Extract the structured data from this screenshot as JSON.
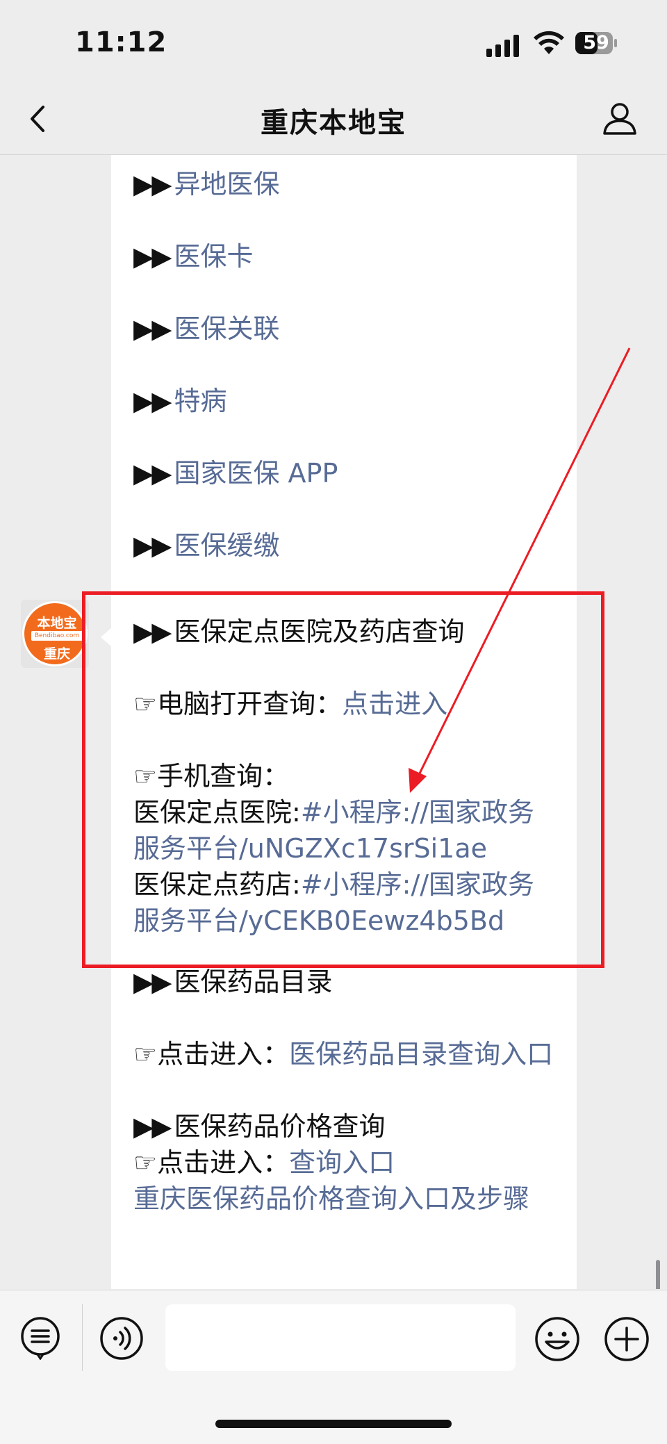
{
  "status_bar": {
    "time": "11:12",
    "battery": "59"
  },
  "nav": {
    "title": "重庆本地宝"
  },
  "bubble1": {
    "items": [
      {
        "marker": "▶▶",
        "label": "异地医保"
      },
      {
        "marker": "▶▶",
        "label": "医保卡"
      },
      {
        "marker": "▶▶",
        "label": "医保关联"
      },
      {
        "marker": "▶▶",
        "label": "特病"
      },
      {
        "marker": "▶▶",
        "label": "国家医保 APP"
      },
      {
        "marker": "▶▶",
        "label": "医保缓缴"
      }
    ]
  },
  "avatar": {
    "top_text": "本地宝",
    "mid_text": "Bendibao.com",
    "bottom_text": "重庆"
  },
  "bubble2": {
    "section1_marker": "▶▶",
    "section1_title": "医保定点医院及药店查询",
    "hand": "☞",
    "pc_label": "电脑打开查询：",
    "pc_link": "点击进入",
    "mobile_label": "手机查询：",
    "hospital_label": "医保定点医院:",
    "hospital_link": "#小程序://国家政务服务平台/uNGZXc17srSi1ae",
    "pharmacy_label": "医保定点药店:",
    "pharmacy_link": "#小程序://国家政务服务平台/yCEKB0Eewz4b5Bd",
    "section2_marker": "▶▶",
    "section2_title": "医保药品目录",
    "catalog_label": "点击进入：",
    "catalog_link": "医保药品目录查询入口",
    "section3_marker": "▶▶",
    "section3_title": "医保药品价格查询",
    "price_label": "点击进入：",
    "price_link": "查询入口",
    "price_link2": "重庆医保药品价格查询入口及步骤"
  },
  "colors": {
    "link": "#576b95",
    "highlight": "#ec1c24",
    "background": "#ededed"
  }
}
